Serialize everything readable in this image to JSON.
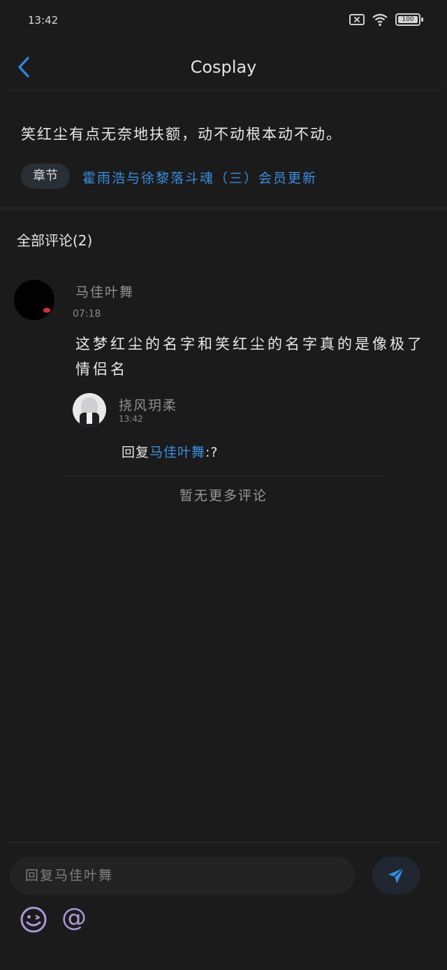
{
  "status_bar": {
    "time": "13:42",
    "battery": "100"
  },
  "header": {
    "title": "Cosplay"
  },
  "post": {
    "text": "笑红尘有点无奈地扶额，动不动根本动不动。",
    "chapter_tag": "章节",
    "chapter_link": "霍雨浩与徐黎落斗魂（三）会员更新"
  },
  "comments": {
    "title": "全部评论(2)",
    "items": [
      {
        "name": "马佳叶舞",
        "time": "07:18",
        "text": "这梦红尘的名字和笑红尘的名字真的是像极了情侣名",
        "reply": {
          "name": "挠风玥柔",
          "time": "13:42",
          "prefix": "回复",
          "target": "马佳叶舞",
          "body": ":?"
        }
      }
    ],
    "no_more": "暂无更多评论"
  },
  "bottom_bar": {
    "placeholder": "回复马佳叶舞"
  },
  "colors": {
    "background": "#1b1b1c",
    "accent": "#3a8ede",
    "icon_purple": "#a99ad8"
  }
}
